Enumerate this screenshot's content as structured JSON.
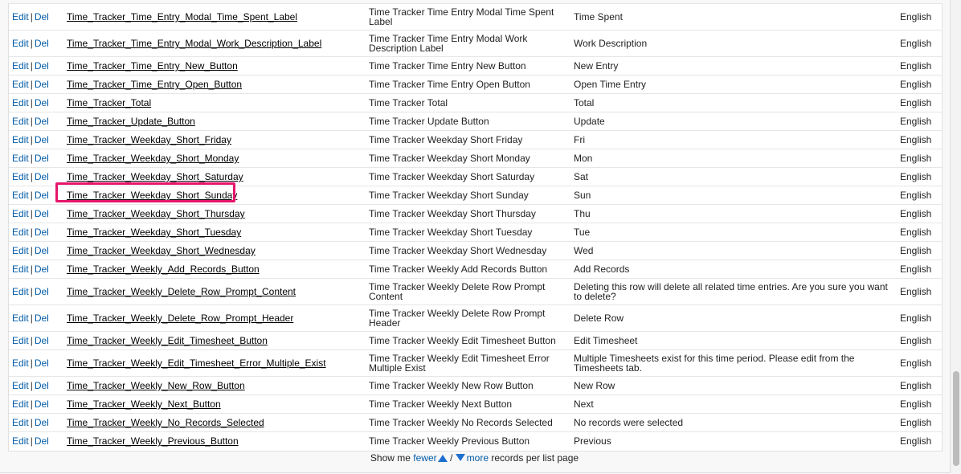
{
  "colors": {
    "link": "#015ba7",
    "highlight": "#e6156b",
    "arrow": "#1f6fd1"
  },
  "row_actions": {
    "edit": "Edit",
    "sep": "|",
    "del": "Del"
  },
  "rows": [
    {
      "name": "Time_Tracker_Time_Entry_Modal_Time_Spent_Label",
      "desc": "Time Tracker Time Entry Modal Time Spent Label",
      "value": "Time Spent",
      "lang": "English",
      "tall": true
    },
    {
      "name": "Time_Tracker_Time_Entry_Modal_Work_Description_Label",
      "desc": "Time Tracker Time Entry Modal Work Description Label",
      "value": "Work Description",
      "lang": "English",
      "tall": true
    },
    {
      "name": "Time_Tracker_Time_Entry_New_Button",
      "desc": "Time Tracker Time Entry New Button",
      "value": "New Entry",
      "lang": "English"
    },
    {
      "name": "Time_Tracker_Time_Entry_Open_Button",
      "desc": "Time Tracker Time Entry Open Button",
      "value": "Open Time Entry",
      "lang": "English"
    },
    {
      "name": "Time_Tracker_Total",
      "desc": "Time Tracker Total",
      "value": "Total",
      "lang": "English"
    },
    {
      "name": "Time_Tracker_Update_Button",
      "desc": "Time Tracker Update Button",
      "value": "Update",
      "lang": "English"
    },
    {
      "name": "Time_Tracker_Weekday_Short_Friday",
      "desc": "Time Tracker Weekday Short Friday",
      "value": "Fri",
      "lang": "English"
    },
    {
      "name": "Time_Tracker_Weekday_Short_Monday",
      "desc": "Time Tracker Weekday Short Monday",
      "value": "Mon",
      "lang": "English"
    },
    {
      "name": "Time_Tracker_Weekday_Short_Saturday",
      "desc": "Time Tracker Weekday Short Saturday",
      "value": "Sat",
      "lang": "English"
    },
    {
      "name": "Time_Tracker_Weekday_Short_Sunday",
      "desc": "Time Tracker Weekday Short Sunday",
      "value": "Sun",
      "lang": "English",
      "highlighted": true
    },
    {
      "name": "Time_Tracker_Weekday_Short_Thursday",
      "desc": "Time Tracker Weekday Short Thursday",
      "value": "Thu",
      "lang": "English"
    },
    {
      "name": "Time_Tracker_Weekday_Short_Tuesday",
      "desc": "Time Tracker Weekday Short Tuesday",
      "value": "Tue",
      "lang": "English"
    },
    {
      "name": "Time_Tracker_Weekday_Short_Wednesday",
      "desc": "Time Tracker Weekday Short Wednesday",
      "value": "Wed",
      "lang": "English"
    },
    {
      "name": "Time_Tracker_Weekly_Add_Records_Button",
      "desc": "Time Tracker Weekly Add Records Button",
      "value": "Add Records",
      "lang": "English"
    },
    {
      "name": "Time_Tracker_Weekly_Delete_Row_Prompt_Content",
      "desc": "Time Tracker Weekly Delete Row Prompt Content",
      "value": "Deleting this row will delete all related time entries. Are you sure you want to delete?",
      "lang": "English",
      "tall": true
    },
    {
      "name": "Time_Tracker_Weekly_Delete_Row_Prompt_Header",
      "desc": "Time Tracker Weekly Delete Row Prompt Header",
      "value": "Delete Row",
      "lang": "English",
      "tall": true
    },
    {
      "name": "Time_Tracker_Weekly_Edit_Timesheet_Button",
      "desc": "Time Tracker Weekly Edit Timesheet Button",
      "value": "Edit Timesheet",
      "lang": "English"
    },
    {
      "name": "Time_Tracker_Weekly_Edit_Timesheet_Error_Multiple_Exist",
      "desc": "Time Tracker Weekly Edit Timesheet Error Multiple Exist",
      "value": "Multiple Timesheets exist for this time period. Please edit from the Timesheets tab.",
      "lang": "English",
      "tall": true
    },
    {
      "name": "Time_Tracker_Weekly_New_Row_Button",
      "desc": "Time Tracker Weekly New Row Button",
      "value": "New Row",
      "lang": "English"
    },
    {
      "name": "Time_Tracker_Weekly_Next_Button",
      "desc": "Time Tracker Weekly Next Button",
      "value": "Next",
      "lang": "English"
    },
    {
      "name": "Time_Tracker_Weekly_No_Records_Selected",
      "desc": "Time Tracker Weekly No Records Selected",
      "value": "No records were selected",
      "lang": "English"
    },
    {
      "name": "Time_Tracker_Weekly_Previous_Button",
      "desc": "Time Tracker Weekly Previous Button",
      "value": "Previous",
      "lang": "English"
    }
  ],
  "footer": {
    "prefix": "Show me",
    "fewer": "fewer",
    "slash": "/",
    "more": "more",
    "suffix": "records per list page",
    "fewer_icon": "triangle-up-icon",
    "more_icon": "triangle-down-icon"
  }
}
